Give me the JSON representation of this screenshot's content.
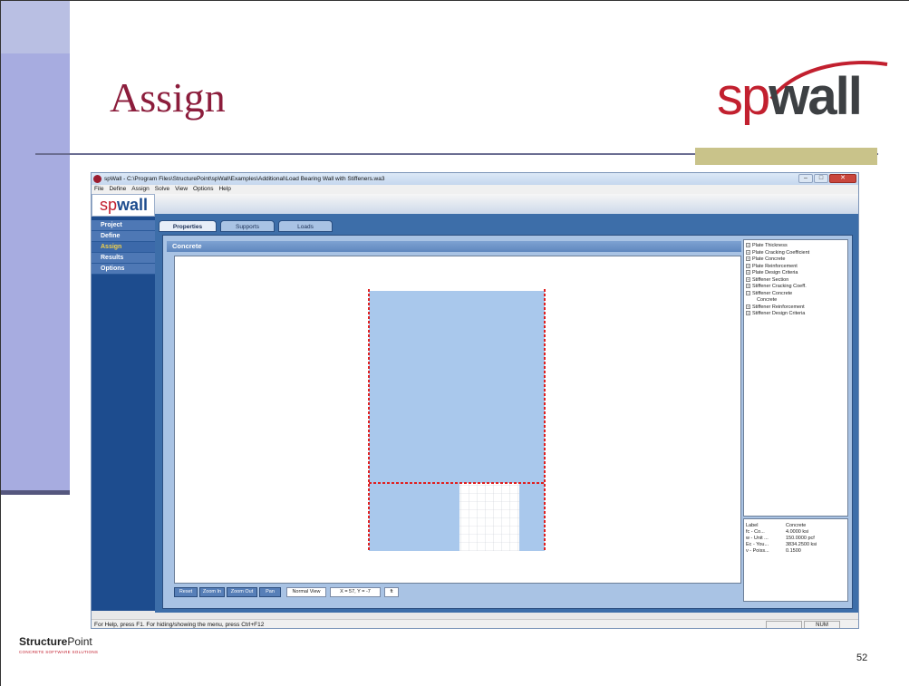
{
  "slide": {
    "title": "Assign",
    "logo_sp": "sp",
    "logo_wall": "wall",
    "footer_logo_bold": "Structure",
    "footer_logo_rest": "Point",
    "footer_tagline": "CONCRETE SOFTWARE SOLUTIONS",
    "page_number": "52"
  },
  "colors": {
    "title": "#8c1d3c",
    "nav_background": "#1d4c8e",
    "nav_active_text": "#f2d14a",
    "panel_background": "#a9c3e4",
    "wall_fill": "#a9c8ec",
    "support_line": "#e02020"
  },
  "app": {
    "window_title": "spWall - C:\\Program Files\\StructurePoint\\spWall\\Examples\\Additional\\Load Bearing Wall with Stiffeners.wa3",
    "window_buttons": {
      "minimize": "–",
      "maximize": "□",
      "close": "✕"
    },
    "menu": [
      "File",
      "Define",
      "Assign",
      "Solve",
      "View",
      "Options",
      "Help"
    ],
    "nav_logo_sp": "sp",
    "nav_logo_wall": "wall",
    "nav": [
      "Project",
      "Define",
      "Assign",
      "Results",
      "Options"
    ],
    "nav_active": "Assign",
    "tabs": [
      "Properties",
      "Supports",
      "Loads"
    ],
    "active_tab": "Properties",
    "panel_title": "Concrete",
    "tree": [
      {
        "label": "Plate Thickness",
        "expander": "+"
      },
      {
        "label": "Plate Cracking Coefficient",
        "expander": "+"
      },
      {
        "label": "Plate Concrete",
        "expander": "+"
      },
      {
        "label": "Plate Reinforcement",
        "expander": "+"
      },
      {
        "label": "Plate Design Criteria",
        "expander": "+"
      },
      {
        "label": "Stiffener Section",
        "expander": "+"
      },
      {
        "label": "Stiffener Cracking Coeff.",
        "expander": "+"
      },
      {
        "label": "Stiffener Concrete",
        "expander": "−"
      },
      {
        "label": "Concrete",
        "expander": ""
      },
      {
        "label": "Stiffener Reinforcement",
        "expander": "+"
      },
      {
        "label": "Stiffener Design Criteria",
        "expander": "+"
      }
    ],
    "properties": [
      {
        "key": "Label",
        "value": "Concrete"
      },
      {
        "key": "fc - Co...",
        "value": "4.0000 ksi"
      },
      {
        "key": "w - Unit ...",
        "value": "150.0000 pcf"
      },
      {
        "key": "Ec - You...",
        "value": "3834.2500 ksi"
      },
      {
        "key": "ν - Poiss...",
        "value": "0.1500"
      }
    ],
    "toolbar": {
      "reset": "Reset",
      "zoom_in": "Zoom In",
      "zoom_out": "Zoom Out",
      "pan": "Pan",
      "view_mode": "Normal View",
      "coords": "X = 57, Y = -7",
      "extra": "ft"
    },
    "status_text": "For Help, press F1. For hiding/showing the menu, press Ctrl+F12",
    "status_num": "NUM"
  }
}
